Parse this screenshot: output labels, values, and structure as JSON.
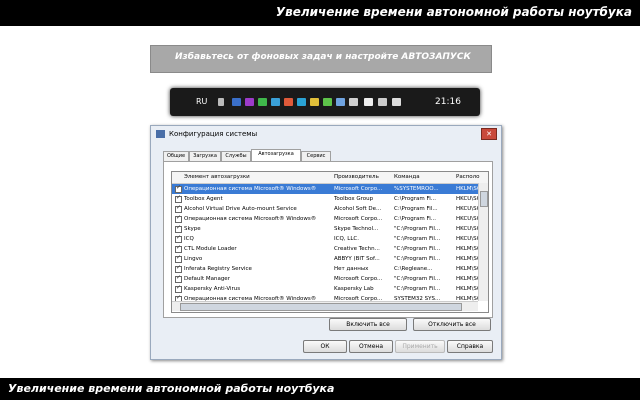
{
  "header": {
    "title": "Увеличение времени автономной работы ноутбука"
  },
  "footer": {
    "title": "Увеличение времени автономной работы ноутбука"
  },
  "banner": {
    "text": "Избавьтесь от фоновых задач и настройте АВТОЗАПУСК"
  },
  "taskbar": {
    "lang": "RU",
    "clock": "21:16"
  },
  "dialog": {
    "title": "Конфигурация системы",
    "close": "✕",
    "tabs": [
      "Общие",
      "Загрузка",
      "Службы",
      "Автозагрузка",
      "Сервис"
    ],
    "active_tab": "Автозагрузка",
    "columns": [
      "Элемент автозагрузки",
      "Производитель",
      "Команда",
      "Располо"
    ],
    "rows": [
      [
        "Операционная система Microsoft® Windows®",
        "Microsoft Corpo...",
        "%SYSTEMROO...",
        "HKLM\\SO"
      ],
      [
        "Toolbox Agent",
        "Toolbox Group",
        "C:\\Program Fi...",
        "HKCU\\SO"
      ],
      [
        "Alcohol Virtual Drive Auto-mount Service",
        "Alcohol Soft De...",
        "C:\\Program Fil...",
        "HKCU\\SO"
      ],
      [
        "Операционная система Microsoft® Windows®",
        "Microsoft Corpo...",
        "C:\\Program Fi...",
        "HKCU\\SO"
      ],
      [
        "Skype",
        "Skype Technol...",
        "\"C:\\Program Fil...",
        "HKCU\\SO"
      ],
      [
        "ICQ",
        "ICQ, LLC.",
        "\"C:\\Program Fil...",
        "HKCU\\SO"
      ],
      [
        "CTL Module Loader",
        "Creative Techn...",
        "\"C:\\Program Fil...",
        "HKLM\\SO"
      ],
      [
        "Lingvo",
        "ABBYY (BIT Sof...",
        "\"C:\\Program Fil...",
        "HKLM\\SO"
      ],
      [
        "Inferata Registry Service",
        "Нет данных",
        "C:\\Regleane...",
        "HKLM\\SO"
      ],
      [
        "Default Manager",
        "Microsoft Corpo...",
        "\"C:\\Program Fil...",
        "HKLM\\SO"
      ],
      [
        "Kaspersky Anti-Virus",
        "Kaspersky Lab",
        "\"C:\\Program Fil...",
        "HKLM\\SO"
      ],
      [
        "Операционная система Microsoft® Windows®",
        "Microsoft Corpo...",
        "SYSTEM32 SYS...",
        "HKLM\\SO"
      ]
    ],
    "enable_all": "Включить все",
    "disable_all": "Отключить все",
    "ok": "ОК",
    "cancel": "Отмена",
    "apply": "Применить",
    "help": "Справка"
  }
}
